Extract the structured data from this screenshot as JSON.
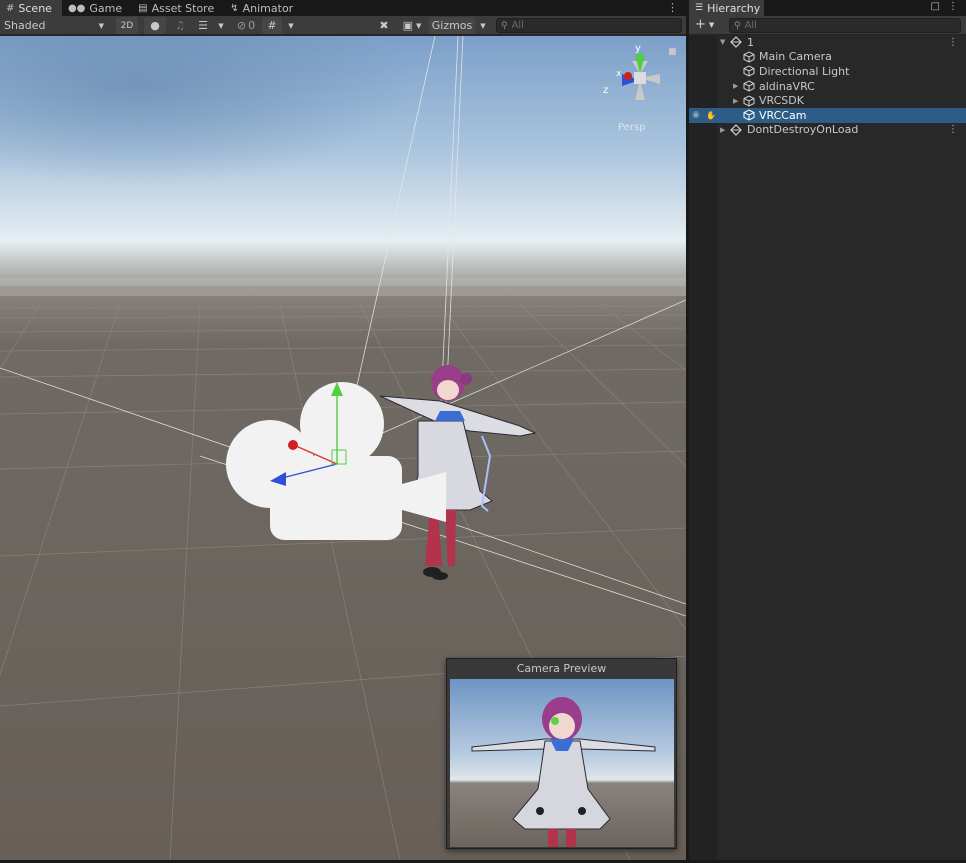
{
  "scene_panel": {
    "tabs": [
      {
        "label": "Scene",
        "icon": "grid-icon",
        "active": true
      },
      {
        "label": "Game",
        "icon": "gamepad-icon",
        "active": false
      },
      {
        "label": "Asset Store",
        "icon": "store-bag-icon",
        "active": false
      },
      {
        "label": "Animator",
        "icon": "animator-icon",
        "active": false
      }
    ],
    "toolbar": {
      "draw_mode": "Shaded",
      "mode_2d": "2D",
      "hidden_count": "0",
      "gizmos_label": "Gizmos",
      "search_placeholder": "All"
    },
    "orientation_gizmo": {
      "y_label": "y",
      "x_label": "x",
      "z_label": "z",
      "projection_label": "Persp"
    }
  },
  "camera_preview": {
    "title": "Camera Preview"
  },
  "hierarchy": {
    "tab_label": "Hierarchy",
    "search_placeholder": "All",
    "items": [
      {
        "label": "1",
        "type": "scene",
        "expanded": true
      },
      {
        "label": "Main Camera",
        "type": "gameobject"
      },
      {
        "label": "Directional Light",
        "type": "gameobject"
      },
      {
        "label": "aldinaVRC",
        "type": "gameobject",
        "collapsed": true
      },
      {
        "label": "VRCSDK",
        "type": "gameobject",
        "collapsed": true
      },
      {
        "label": "VRCCam",
        "type": "gameobject",
        "selected": true
      },
      {
        "label": "DontDestroyOnLoad",
        "type": "scene",
        "collapsed": true
      }
    ]
  },
  "colors": {
    "selection": "#2c5d87",
    "panel": "#282828",
    "toolbar": "#3c3c3c",
    "axis_x": "#e03030",
    "axis_y": "#50d040",
    "axis_z": "#2f4fd8"
  }
}
